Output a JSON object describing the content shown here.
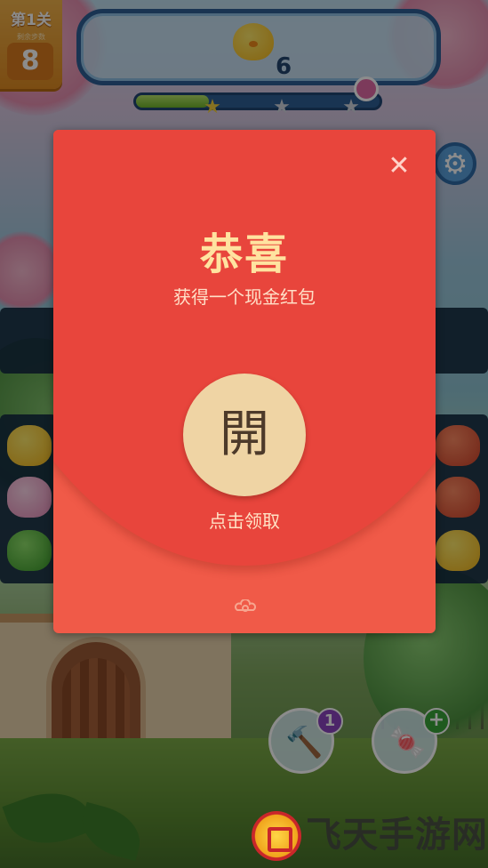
{
  "hud": {
    "level_title": "第1关",
    "moves_label": "剩余步数",
    "moves_left": "8",
    "target_count": "6",
    "target_icon": "chick-icon",
    "progress_fraction": 0.3,
    "settings_icon": "gear-icon"
  },
  "boosters": {
    "hammer_count": "1",
    "candy_plus": "+"
  },
  "modal": {
    "title": "恭喜",
    "subtitle": "获得一个现金红包",
    "open_char": "開",
    "tap_label": "点击领取",
    "close_icon": "close-icon",
    "close_glyph": "✕",
    "accent_color": "#f05a48",
    "button_color": "#efd4a4"
  },
  "watermark": {
    "text": "飞天手游网"
  }
}
